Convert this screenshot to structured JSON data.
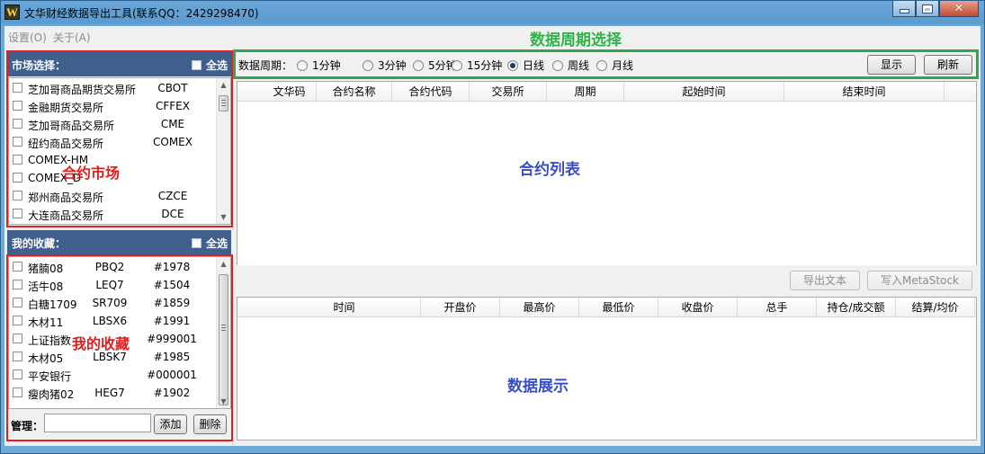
{
  "window": {
    "title": "文华财经数据导出工具(联系QQ：2429298470)",
    "icon": "W"
  },
  "menu": [
    "设置(O)",
    "关于(A)"
  ],
  "annotations": {
    "period": "数据周期选择",
    "market": "合约市场",
    "favorites": "我的收藏",
    "contract_list": "合约列表",
    "data_display": "数据展示"
  },
  "market_panel": {
    "title": "市场选择：",
    "select_all": "全选",
    "items": [
      {
        "name": "芝加哥商品期货交易所",
        "code": "CBOT"
      },
      {
        "name": "金融期货交易所",
        "code": "CFFEX"
      },
      {
        "name": "芝加哥商品交易所",
        "code": "CME"
      },
      {
        "name": "纽约商品交易所",
        "code": "COMEX"
      },
      {
        "name": "COMEX-HM",
        "code": ""
      },
      {
        "name": "COMEX_D",
        "code": ""
      },
      {
        "name": "郑州商品交易所",
        "code": "CZCE"
      },
      {
        "name": "大连商品交易所",
        "code": "DCE"
      }
    ]
  },
  "favorites_panel": {
    "title": "我的收藏：",
    "select_all": "全选",
    "items": [
      {
        "name": "猪腩08",
        "code": "PBQ2",
        "id": "#1978"
      },
      {
        "name": "活牛08",
        "code": "LEQ7",
        "id": "#1504"
      },
      {
        "name": "白糖1709",
        "code": "SR709",
        "id": "#1859"
      },
      {
        "name": "木材11",
        "code": "LBSX6",
        "id": "#1991"
      },
      {
        "name": "上证指数",
        "code": "",
        "id": "#999001"
      },
      {
        "name": "木材05",
        "code": "LBSK7",
        "id": "#1985"
      },
      {
        "name": "平安银行",
        "code": "",
        "id": "#000001"
      },
      {
        "name": "瘦肉猪02",
        "code": "HEG7",
        "id": "#1902"
      }
    ],
    "manage_label": "管理：",
    "manage_value": "",
    "add_button": "添加",
    "delete_button": "删除"
  },
  "period_bar": {
    "label": "数据周期：",
    "options": [
      "1分钟",
      "3分钟",
      "5分钟",
      "15分钟",
      "日线",
      "周线",
      "月线"
    ],
    "selected": "日线",
    "show_button": "显示",
    "refresh_button": "刷新"
  },
  "contract_table": {
    "columns": [
      "文华码",
      "合约名称",
      "合约代码",
      "交易所",
      "周期",
      "起始时间",
      "结束时间"
    ],
    "rows": []
  },
  "export": {
    "text_button": "导出文本",
    "metastock_button": "写入MetaStock"
  },
  "data_table": {
    "columns": [
      "时间",
      "开盘价",
      "最高价",
      "最低价",
      "收盘价",
      "总手",
      "持仓/成交额",
      "结算/均价"
    ],
    "rows": []
  }
}
